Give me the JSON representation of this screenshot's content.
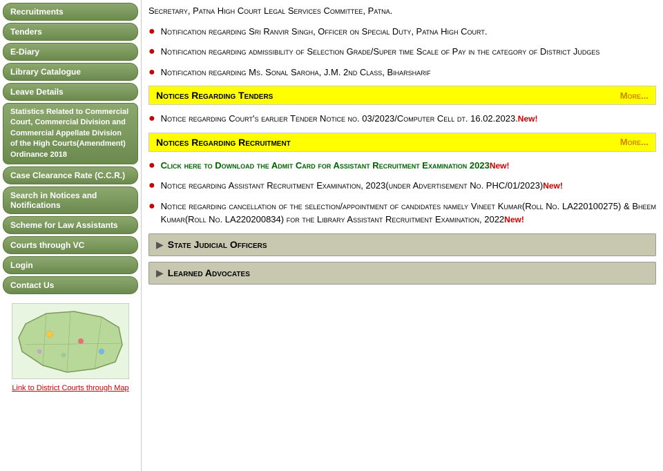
{
  "sidebar": {
    "items": [
      {
        "label": "Recruitments",
        "id": "recruitments"
      },
      {
        "label": "Tenders",
        "id": "tenders"
      },
      {
        "label": "E-Diary",
        "id": "e-diary"
      },
      {
        "label": "Library Catalogue",
        "id": "library-catalogue"
      },
      {
        "label": "Leave Details",
        "id": "leave-details"
      },
      {
        "label": "Statistics Related to Commercial Court, Commercial Division and Commercial Appellate Division of the High Courts(Amendment) Ordinance 2018",
        "id": "statistics",
        "multi": true
      },
      {
        "label": "Case Clearance Rate (C.C.R.)",
        "id": "ccr"
      },
      {
        "label": "Search in Notices and Notifications",
        "id": "search-notices"
      },
      {
        "label": "Scheme for Law Assistants",
        "id": "scheme-assistants"
      },
      {
        "label": "Courts through VC",
        "id": "courts-vc"
      },
      {
        "label": "Login",
        "id": "login"
      },
      {
        "label": "Contact Us",
        "id": "contact-us"
      }
    ],
    "map_link": "Link to District Courts through Map"
  },
  "main": {
    "top_notification": "Secretary, Patna High Court Legal Services Committee, Patna.",
    "notifications": [
      {
        "id": "notif1",
        "text": "Notification regarding Sri Ranvir Singh, Officer on Special Duty, Patna High Court."
      },
      {
        "id": "notif2",
        "text": "Notification regarding admissibility of Selection Grade/Super time Scale of Pay in the category of District Judges"
      },
      {
        "id": "notif3",
        "text": "Notification regarding Ms. Sonal Saroha, J.M. 2nd Class, Biharsharif"
      }
    ],
    "tenders_section": {
      "title": "Notices Regarding Tenders",
      "more_label": "More...",
      "items": [
        {
          "id": "tender1",
          "text": "Notice regarding Court's earlier Tender Notice no. 03/2023/Computer Cell dt. 16.02.2023.",
          "new": true
        }
      ]
    },
    "recruitment_section": {
      "title": "Notices Regarding Recruitment",
      "more_label": "More...",
      "items": [
        {
          "id": "rec1",
          "text": "Click here to Download the Admit Card for Assistant Recruitment Examination 2023",
          "new": true,
          "green": true
        },
        {
          "id": "rec2",
          "text": "Notice regarding Assistant Recruitment Examination, 2023(under Advertisement No. PHC/01/2023)",
          "new": true,
          "green": false
        },
        {
          "id": "rec3",
          "text": "Notice regarding cancellation of the selection/appointment of candidates namely Vineet Kumar(Roll No. LA220100275) & Bheem Kumar(Roll No. LA220200834) for the Library Assistant Recruitment Examination, 2022",
          "new": true,
          "green": false
        }
      ]
    },
    "collapsible_sections": [
      {
        "id": "state-judicial",
        "title": "State Judicial Officers"
      },
      {
        "id": "learned-advocates",
        "title": "Learned Advocates"
      }
    ]
  }
}
